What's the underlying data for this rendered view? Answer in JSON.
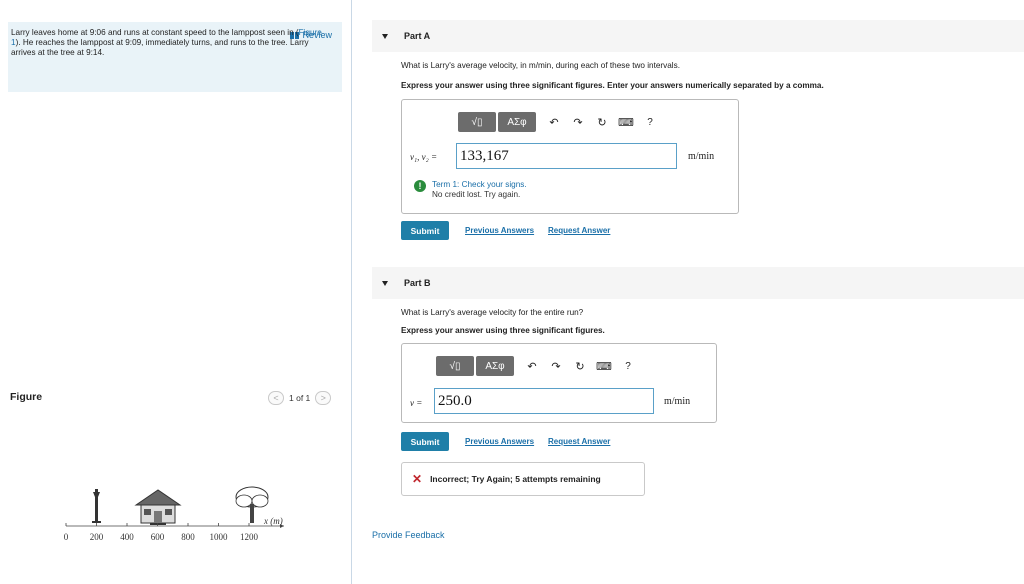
{
  "problem": {
    "review_label": "Review",
    "text_before": "Larry leaves home at 9:06 and runs at constant speed to the lamppost seen in (",
    "figure_link": "Figure 1",
    "text_after": "). He reaches the lamppost at 9:09, immediately turns, and runs to the tree. Larry arrives at the tree at 9:14."
  },
  "figure": {
    "label": "Figure",
    "pager_text": "1 of 1",
    "prev_symbol": "<",
    "next_symbol": ">",
    "axis_ticks": [
      "0",
      "200",
      "400",
      "600",
      "800",
      "1000",
      "1200"
    ],
    "axis_label": "x (m)"
  },
  "partA": {
    "title": "Part A",
    "question": "What is Larry's average velocity, in m/min, during each of these two intervals.",
    "instruction": "Express your answer using three significant figures. Enter your answers numerically separated by a comma.",
    "toolbar": {
      "sqrt": "√▯",
      "greek": "ΑΣφ",
      "undo": "↶",
      "redo": "↷",
      "reset": "↻",
      "keyboard": "⌨",
      "help": "?"
    },
    "var_label": "v₁, v₂ =",
    "answer_value": "133,167",
    "unit": "m/min",
    "warn_title": "Term 1: Check your signs.",
    "warn_detail": "No credit lost. Try again.",
    "submit": "Submit",
    "previous_answers": "Previous Answers",
    "request_answer": "Request Answer"
  },
  "partB": {
    "title": "Part B",
    "question": "What is Larry's average velocity for the entire run?",
    "instruction": "Express your answer using three significant figures.",
    "toolbar": {
      "sqrt": "√▯",
      "greek": "ΑΣφ",
      "undo": "↶",
      "redo": "↷",
      "reset": "↻",
      "keyboard": "⌨",
      "help": "?"
    },
    "var_label": "v =",
    "answer_value": "250.0",
    "unit": "m/min",
    "submit": "Submit",
    "previous_answers": "Previous Answers",
    "request_answer": "Request Answer",
    "incorrect_text": "Incorrect; Try Again; 5 attempts remaining"
  },
  "footer": {
    "provide_feedback": "Provide Feedback"
  },
  "colors": {
    "accent": "#1a6fa8",
    "submit_bg": "#1f7fa8",
    "error": "#c0262d",
    "warn": "#2a8c3c",
    "problem_bg": "#e9f3f8"
  }
}
